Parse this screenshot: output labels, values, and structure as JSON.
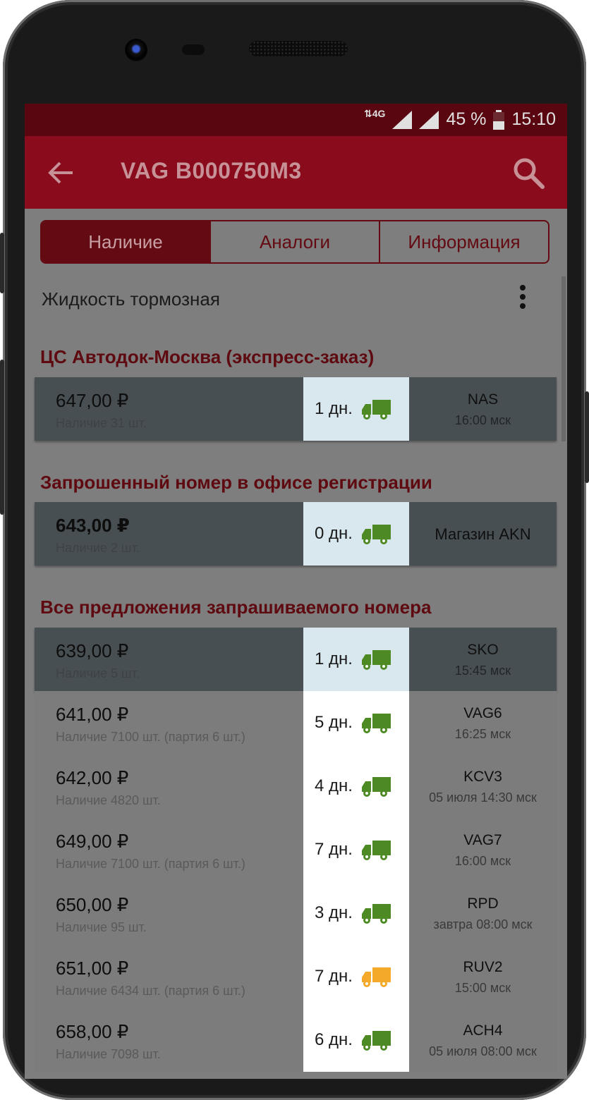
{
  "status_bar": {
    "network": "4G",
    "battery": "45 %",
    "time": "15:10"
  },
  "app_bar": {
    "title": "VAG B000750M3"
  },
  "tabs": [
    {
      "label": "Наличие",
      "active": true
    },
    {
      "label": "Аналоги",
      "active": false
    },
    {
      "label": "Информация",
      "active": false
    }
  ],
  "part_name": "Жидкость тормозная",
  "sections": [
    {
      "title": "ЦС Автодок-Москва (экспресс-заказ)"
    },
    {
      "title": "Запрошенный номер в офисе регистрации"
    },
    {
      "title": "Все предложения запрашиваемого номера"
    }
  ],
  "offers": [
    {
      "price": "647,00 ₽",
      "stock": "Наличие 31 шт.",
      "days": "1 дн.",
      "truck_color": "#4e8a24",
      "supplier": "NAS",
      "supplier_time": "16:00 мск"
    },
    {
      "price": "643,00 ₽",
      "stock": "Наличие 2 шт.",
      "days": "0 дн.",
      "truck_color": "#4e8a24",
      "supplier": "Магазин AKN",
      "supplier_time": ""
    },
    {
      "price": "639,00 ₽",
      "stock": "Наличие 5 шт.",
      "days": "1 дн.",
      "truck_color": "#4e8a24",
      "supplier": "SKO",
      "supplier_time": "15:45 мск"
    },
    {
      "price": "641,00 ₽",
      "stock": "Наличие 7100 шт. (партия 6 шт.)",
      "days": "5 дн.",
      "truck_color": "#4e8a24",
      "supplier": "VAG6",
      "supplier_time": "16:25 мск"
    },
    {
      "price": "642,00 ₽",
      "stock": "Наличие 4820 шт.",
      "days": "4 дн.",
      "truck_color": "#4e8a24",
      "supplier": "KCV3",
      "supplier_time": "05 июля 14:30 мск"
    },
    {
      "price": "649,00 ₽",
      "stock": "Наличие 7100 шт. (партия 6 шт.)",
      "days": "7 дн.",
      "truck_color": "#4e8a24",
      "supplier": "VAG7",
      "supplier_time": "16:00 мск"
    },
    {
      "price": "650,00 ₽",
      "stock": "Наличие 95 шт.",
      "days": "3 дн.",
      "truck_color": "#4e8a24",
      "supplier": "RPD",
      "supplier_time": "завтра 08:00 мск"
    },
    {
      "price": "651,00 ₽",
      "stock": "Наличие 6434 шт. (партия 6 шт.)",
      "days": "7 дн.",
      "truck_color": "#f4a92a",
      "supplier": "RUV2",
      "supplier_time": "15:00 мск"
    },
    {
      "price": "658,00 ₽",
      "stock": "Наличие 7098 шт.",
      "days": "6 дн.",
      "truck_color": "#4e8a24",
      "supplier": "ACH4",
      "supplier_time": "05 июля 08:00 мск"
    }
  ],
  "colors": {
    "accent": "#8a0c1c",
    "status_bar": "#5a0610",
    "dim_overlay": "#7e7e7e"
  }
}
